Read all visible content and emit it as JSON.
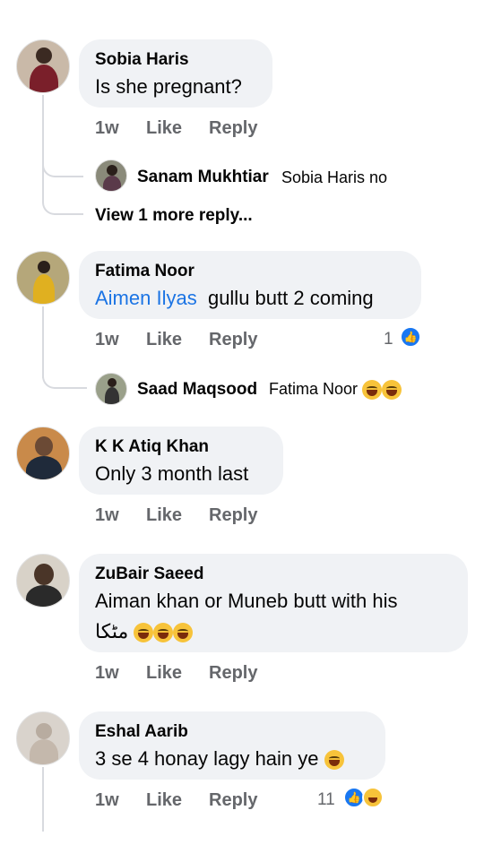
{
  "comments": [
    {
      "author": "Sobia Haris",
      "text": "Is she pregnant?",
      "time": "1w",
      "like": "Like",
      "reply": "Reply",
      "replies": [
        {
          "author": "Sanam Mukhtiar",
          "text": "Sobia Haris no"
        }
      ],
      "view_more": "View 1 more reply..."
    },
    {
      "author": "Fatima Noor",
      "mention": "Aimen Ilyas",
      "text": "gullu butt 2 coming",
      "time": "1w",
      "like": "Like",
      "reply": "Reply",
      "reaction_count": "1",
      "replies": [
        {
          "author": "Saad Maqsood",
          "text": "Fatima Noor"
        }
      ]
    },
    {
      "author": "K K Atiq Khan",
      "text": "Only 3 month last",
      "time": "1w",
      "like": "Like",
      "reply": "Reply"
    },
    {
      "author": "ZuBair Saeed",
      "text": "Aiman khan or Muneb butt with his",
      "text2": "مٹکا",
      "time": "1w",
      "like": "Like",
      "reply": "Reply"
    },
    {
      "author": "Eshal Aarib",
      "text": "3 se 4 honay lagy hain ye",
      "time": "1w",
      "like": "Like",
      "reply": "Reply",
      "reaction_count": "11"
    }
  ],
  "icons": {
    "emoji": "laughing-emoji-icon",
    "like": "like-reaction-icon",
    "haha": "haha-reaction-icon"
  },
  "colors": {
    "bubble": "#f0f2f5",
    "mention": "#1b74e4",
    "secondary_text": "#65676b",
    "like_blue": "#1877f2"
  }
}
